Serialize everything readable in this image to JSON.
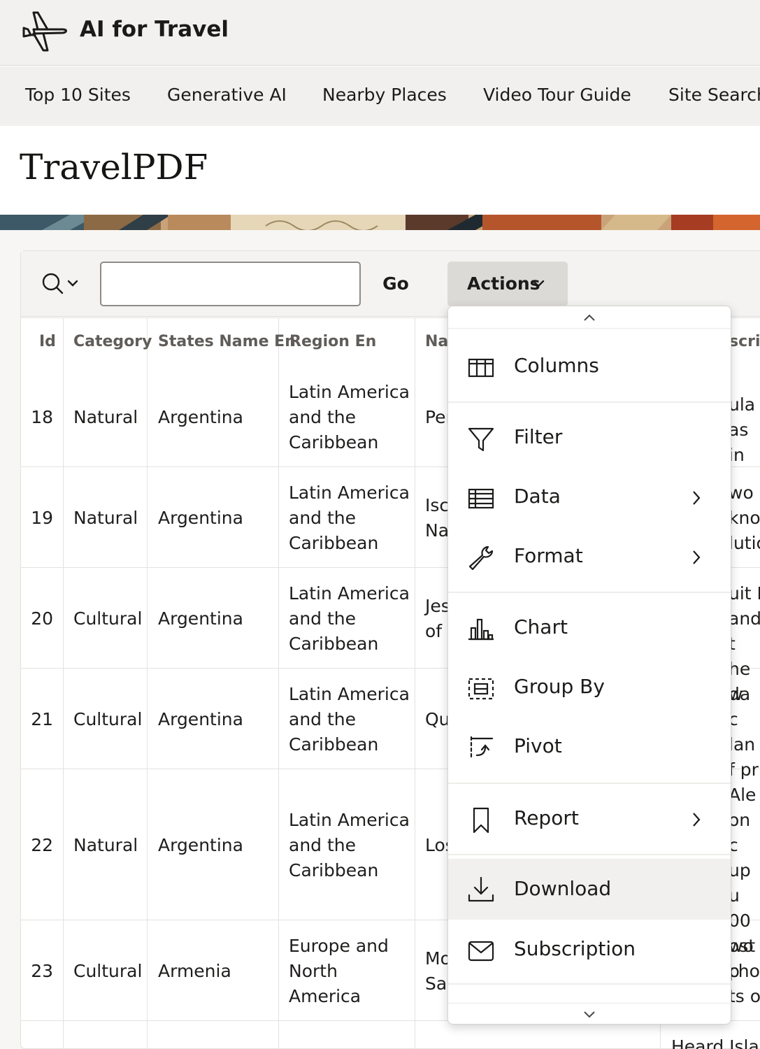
{
  "app": {
    "title": "AI for Travel"
  },
  "nav": {
    "items": [
      "Top 10 Sites",
      "Generative AI",
      "Nearby Places",
      "Video Tour Guide",
      "Site Search"
    ]
  },
  "page": {
    "title": "TravelPDF"
  },
  "toolbar": {
    "search_value": "",
    "go_label": "Go",
    "actions_label": "Actions"
  },
  "table": {
    "columns": [
      "Id",
      "Category",
      "States Name En",
      "Region En",
      "Nar",
      "scrip"
    ],
    "rows": [
      {
        "id": "18",
        "category": "Natural",
        "state": "Argentina",
        "region": "Latin America\nand the\nCaribbean",
        "name": "Per",
        "desc": "ula \nas in"
      },
      {
        "id": "19",
        "category": "Natural",
        "state": "Argentina",
        "region": "Latin America\nand the\nCaribbean",
        "name": "Iscl\nNat",
        "desc": "wo c\nknow\nlutic"
      },
      {
        "id": "20",
        "category": "Cultural",
        "state": "Argentina",
        "region": "Latin America\nand the\nCaribbean",
        "name": "Jes\nof (",
        "desc": "uit I\nand t\nhe w"
      },
      {
        "id": "21",
        "category": "Cultural",
        "state": "Argentina",
        "region": "Latin America\nand the\nCaribbean",
        "name": "Qu",
        "desc": "da c\nlan\nf pr"
      },
      {
        "id": "22",
        "category": "Natural",
        "state": "Argentina",
        "region": "Latin America\nand the\nCaribbean",
        "name": "Los",
        "desc": "Ale\non c\nup u\n00\nost p"
      },
      {
        "id": "23",
        "category": "Cultural",
        "state": "Armenia",
        "region": "Europe and\nNorth\nAmerica",
        "name": "Mo\nSar",
        "desc": "wo l\nchoo\nts of"
      }
    ],
    "partial_row_desc": "Heard Islan"
  },
  "actions_menu": {
    "items": [
      {
        "label": "Columns",
        "icon": "columns-icon",
        "submenu": false
      },
      {
        "label": "Filter",
        "icon": "filter-icon",
        "submenu": false
      },
      {
        "label": "Data",
        "icon": "data-table-icon",
        "submenu": true
      },
      {
        "label": "Format",
        "icon": "wrench-icon",
        "submenu": true
      },
      {
        "label": "Chart",
        "icon": "bar-chart-icon",
        "submenu": false
      },
      {
        "label": "Group By",
        "icon": "group-by-icon",
        "submenu": false
      },
      {
        "label": "Pivot",
        "icon": "pivot-icon",
        "submenu": false
      },
      {
        "label": "Report",
        "icon": "bookmark-icon",
        "submenu": true
      },
      {
        "label": "Download",
        "icon": "download-icon",
        "submenu": false,
        "highlighted": true
      },
      {
        "label": "Subscription",
        "icon": "envelope-icon",
        "submenu": false
      }
    ]
  },
  "colors": {
    "header_bg": "#f2f1ef",
    "actions_bg": "#dcdad6",
    "menu_highlight": "#f1f0ee"
  }
}
